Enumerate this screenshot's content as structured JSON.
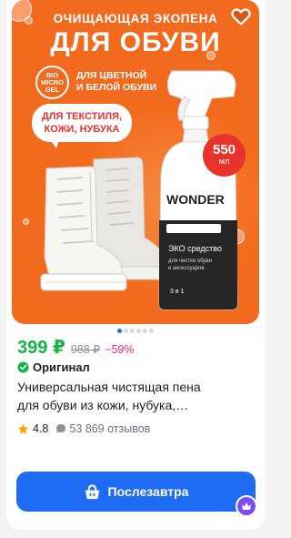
{
  "image": {
    "promo_line1": "ОЧИЩАЮЩАЯ ЭКОПЕНА",
    "promo_line2": "ДЛЯ ОБУВИ",
    "bio_badge": [
      "BIO",
      "MICRO",
      "GEL"
    ],
    "color_text_line1": "ДЛЯ ЦВЕТНОЙ",
    "color_text_line2": "И БЕЛОЙ ОБУВИ",
    "bubble_line1": "ДЛЯ ТЕКСТИЛЯ,",
    "bubble_line2": "КОЖИ, НУБУКА",
    "size_number": "550",
    "size_unit": "мл",
    "brand": "WONDER",
    "bottle_label_line1": "ЭКО средство",
    "bottle_label_line2": "для чистки обуви",
    "bottle_label_line3": "и аксессуаров",
    "bottle_badge": "3 в 1",
    "slides_total": 6,
    "slide_active": 1
  },
  "product": {
    "price": "399 ₽",
    "old_price": "988 ₽",
    "discount": "−59%",
    "original_label": "Оригинал",
    "title_line1": "Универсальная чистящая пена",
    "title_line2": "для обуви из кожи, нубука,…",
    "rating": "4.8",
    "reviews": "53 869 отзывов"
  },
  "actions": {
    "buy_label": "Послезавтра"
  },
  "colors": {
    "photo_bg": "#f26a1e",
    "price_green": "#17b344",
    "discount_pink": "#f0247b",
    "button_blue": "#1d6cf2",
    "accent_red": "#e8332b"
  },
  "icons": [
    "heart-icon",
    "check-badge-icon",
    "star-icon",
    "chat-icon",
    "basket-icon",
    "crown-icon"
  ]
}
